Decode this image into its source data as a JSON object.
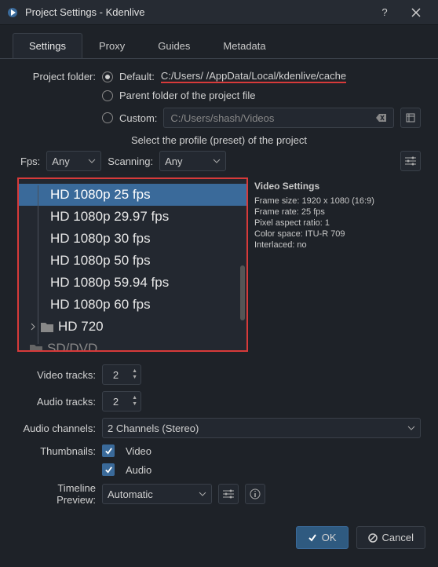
{
  "window": {
    "title": "Project Settings - Kdenlive"
  },
  "tabs": {
    "settings": "Settings",
    "proxy": "Proxy",
    "guides": "Guides",
    "metadata": "Metadata"
  },
  "project_folder": {
    "label": "Project folder:",
    "default_label": "Default:",
    "default_path": "C:/Users/        /AppData/Local/kdenlive/cache",
    "parent_label": "Parent folder of the project file",
    "custom_label": "Custom:",
    "custom_placeholder": "C:/Users/shash/Videos"
  },
  "profile": {
    "header": "Select the profile (preset) of the project",
    "fps_label": "Fps:",
    "fps_value": "Any",
    "scanning_label": "Scanning:",
    "scanning_value": "Any",
    "items": [
      "HD 1080p 25 fps",
      "HD 1080p 29.97 fps",
      "HD 1080p 30 fps",
      "HD 1080p 50 fps",
      "HD 1080p 59.94 fps",
      "HD 1080p 60 fps"
    ],
    "folder1": "HD 720",
    "folder2": "SD/DVD"
  },
  "video_settings": {
    "title": "Video Settings",
    "frame_size": "Frame size: 1920 x 1080 (16:9)",
    "frame_rate": "Frame rate: 25 fps",
    "par": "Pixel aspect ratio: 1",
    "colorspace": "Color space: ITU-R 709",
    "interlaced": "Interlaced: no"
  },
  "tracks": {
    "video_label": "Video tracks:",
    "video_value": "2",
    "audio_label": "Audio tracks:",
    "audio_value": "2",
    "channels_label": "Audio channels:",
    "channels_value": "2 Channels (Stereo)",
    "thumbs_label": "Thumbnails:",
    "thumbs_video": "Video",
    "thumbs_audio": "Audio",
    "preview_label": "Timeline Preview:",
    "preview_value": "Automatic"
  },
  "buttons": {
    "ok": "OK",
    "cancel": "Cancel"
  }
}
